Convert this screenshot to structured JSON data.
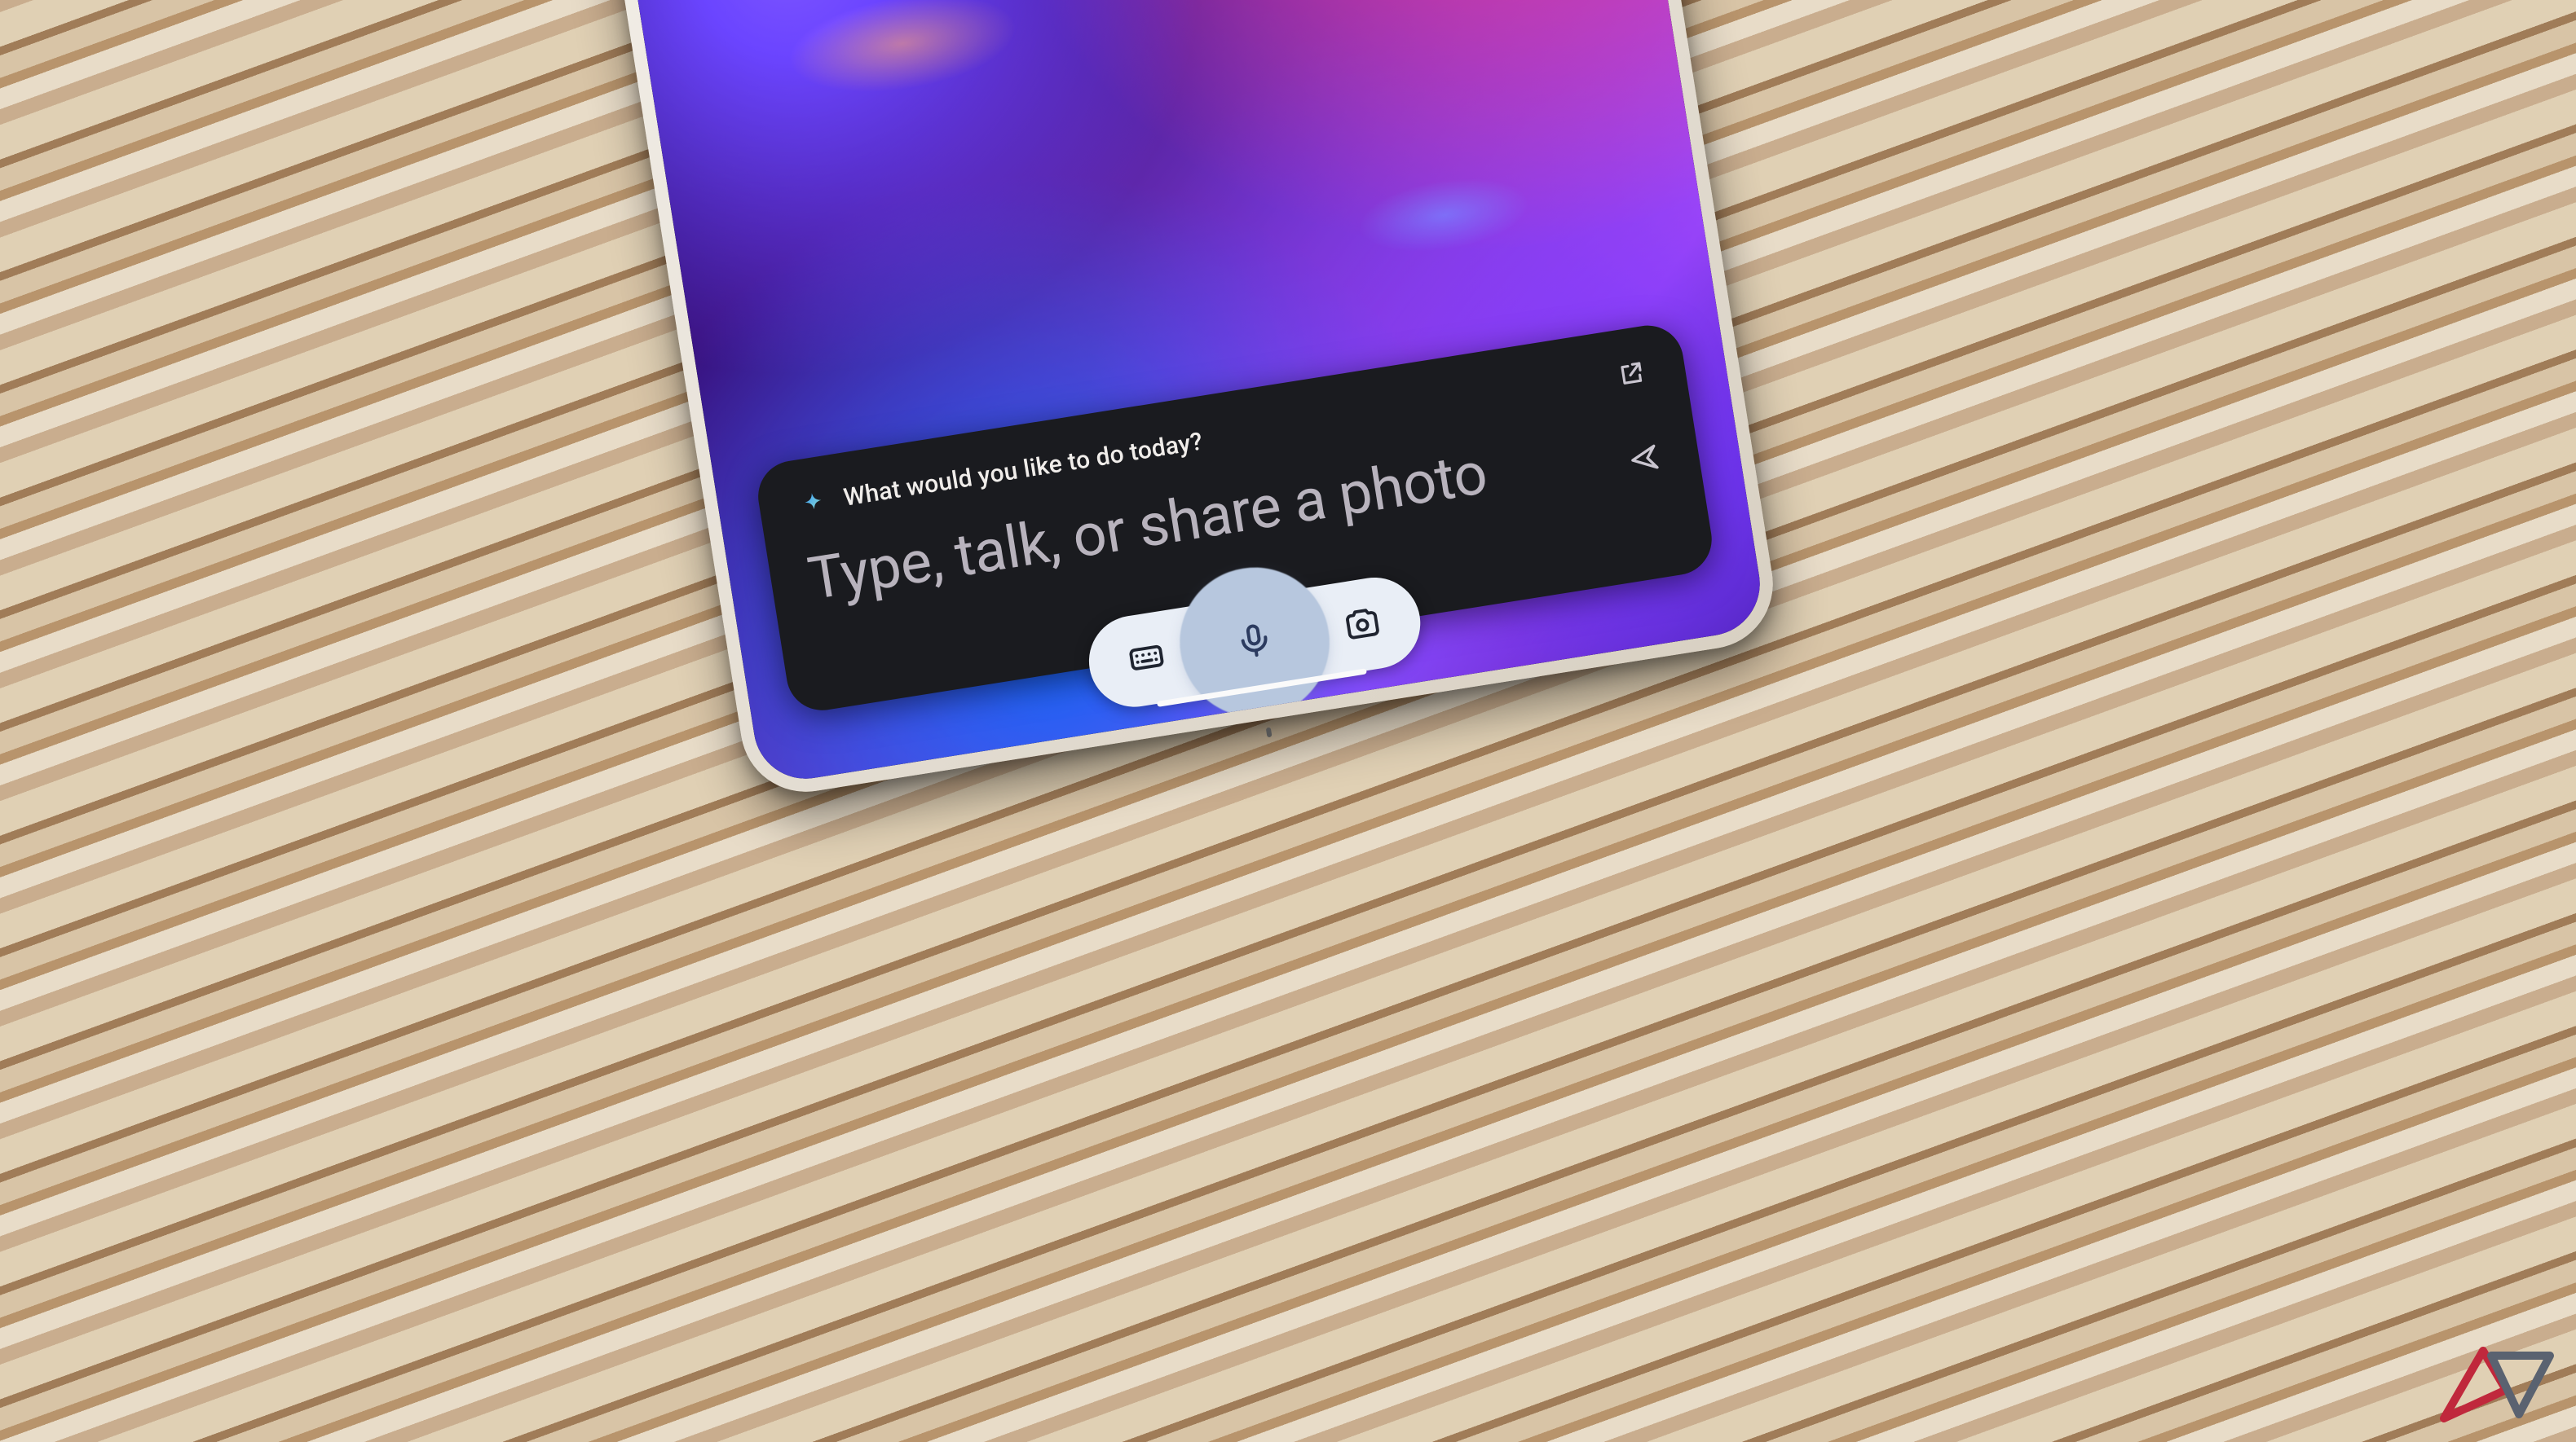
{
  "assistant": {
    "greeting": "What would you like to do today?",
    "placeholder": "Type, talk, or share a photo",
    "icons": {
      "sparkle": "sparkle-icon",
      "expand": "open-in-new-icon",
      "send": "send-sparkle-icon",
      "keyboard": "keyboard-icon",
      "mic": "microphone-icon",
      "camera": "camera-icon"
    }
  },
  "colors": {
    "card_bg": "#1a1b1f",
    "pill_bg": "#e9eef6",
    "mic_blob": "#b7c7de",
    "sparkle_a": "#3aa0ff",
    "sparkle_b": "#8ad8c8"
  }
}
